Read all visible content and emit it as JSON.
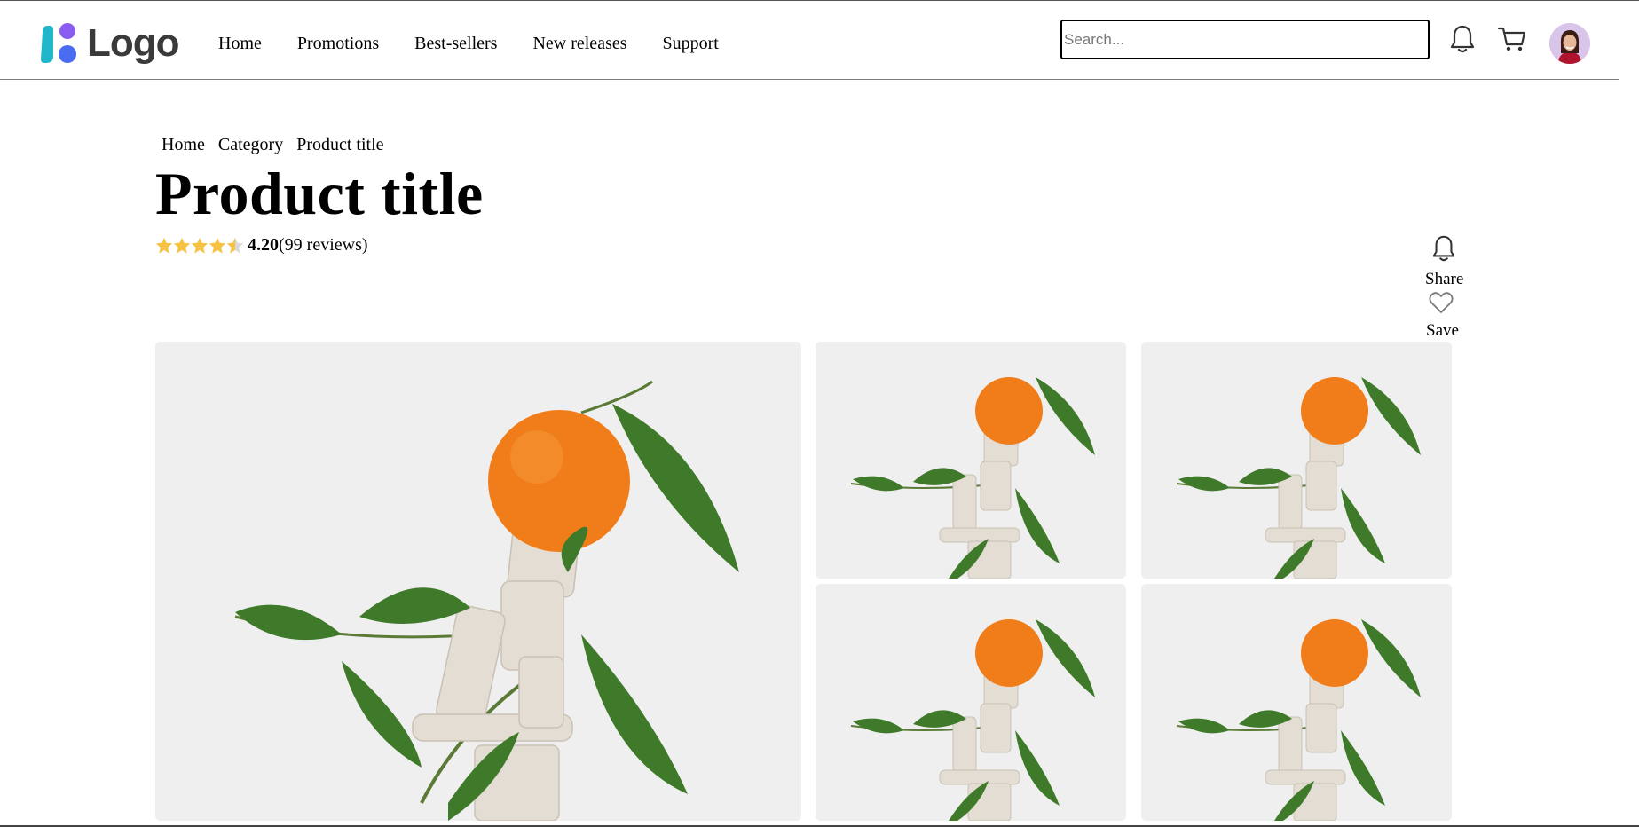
{
  "header": {
    "logo_text": "Logo",
    "nav": [
      "Home",
      "Promotions",
      "Best-sellers",
      "New releases",
      "Support"
    ],
    "search_placeholder": "Search...",
    "icons": [
      "bell-icon",
      "cart-icon",
      "avatar"
    ]
  },
  "breadcrumb": [
    "Home",
    "Category",
    "Product title"
  ],
  "product": {
    "title": "Product title",
    "rating_value": "4.20",
    "rating_fraction": 0.84,
    "reviews": "(99 reviews)"
  },
  "actions": {
    "share_label": "Share",
    "save_label": "Save"
  },
  "colors": {
    "star": "#f5c242",
    "logo_teal": "#1fb7c9",
    "logo_purple": "#8a5cf0",
    "logo_blue": "#4a6cf0",
    "orange": "#f07d1a",
    "leaf": "#3f7a2a",
    "image_bg": "#efefef"
  }
}
